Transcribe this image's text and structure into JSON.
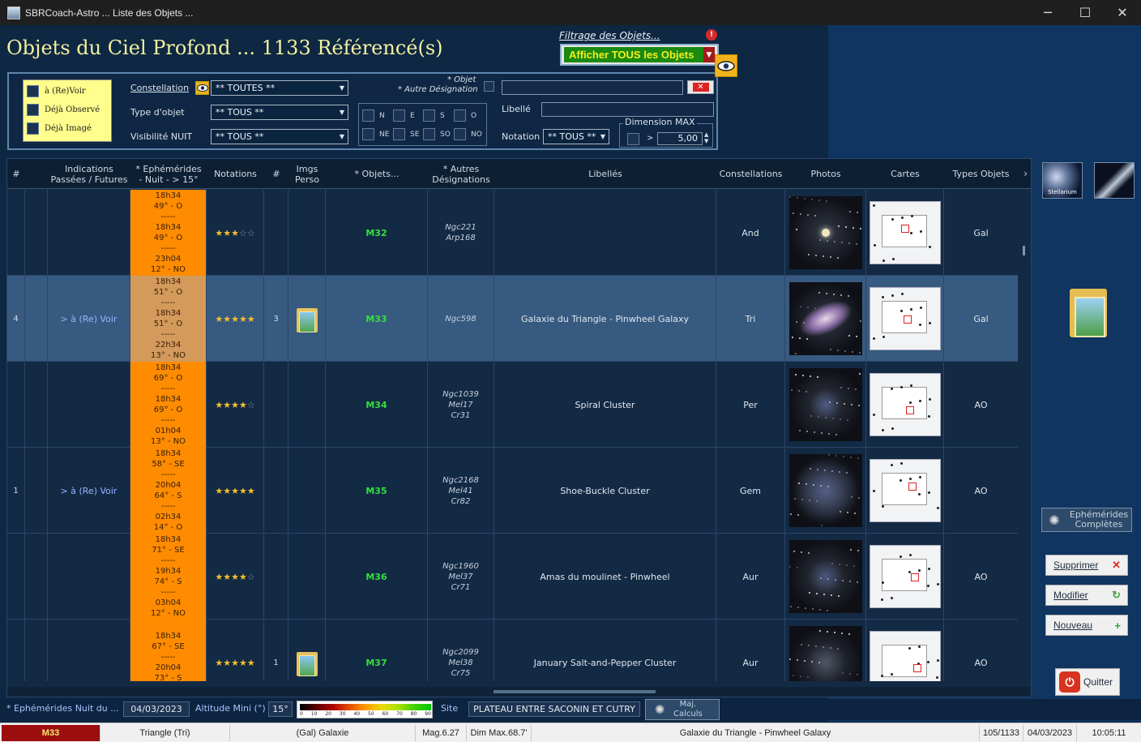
{
  "window": {
    "title": "SBRCoach-Astro ... Liste des Objets ...",
    "minimize": "─",
    "maximize": "☐",
    "close": "✕"
  },
  "header": {
    "title": "Objets du Ciel Profond ... 1133 Référencé(s)"
  },
  "filter": {
    "label": "Filtrage des Objets...",
    "badge": "!",
    "selected": "Afficher TOUS les Objets"
  },
  "legend": {
    "items": [
      "à (Re)Voir",
      "Déjà Observé",
      "Déjà Imagé"
    ]
  },
  "filters": {
    "constellation_label": "Constellation",
    "constellation_value": "** TOUTES **",
    "type_label": "Type d'objet",
    "type_value": "** TOUS **",
    "visibility_label": "Visibilité NUIT",
    "visibility_value": "** TOUS **",
    "object_label_1": "* Objet",
    "object_label_2": "* Autre Désignation",
    "object_value": "",
    "clear_label": "✕",
    "libelle_label": "Libellé",
    "libelle_value": "",
    "directions": [
      "N",
      "E",
      "S",
      "O",
      "NE",
      "SE",
      "SO",
      "NO"
    ],
    "notation_label": "Notation",
    "notation_value": "** TOUS **",
    "dimension_label": "Dimension MAX",
    "dimension_op": ">",
    "dimension_value": "5,00"
  },
  "table": {
    "headers": {
      "num": "#",
      "indications": "Indications\nPassées / Futures",
      "ephemerides": "* Ephémérides\n- Nuit - > 15°",
      "notations": "Notations",
      "hash": "#",
      "imgs": "Imgs\nPerso",
      "objets": "* Objets...",
      "autres": "* Autres\nDésignations",
      "libelles": "Libellés",
      "constellations": "Constellations",
      "photos": "Photos",
      "cartes": "Cartes",
      "types": "Types Objets"
    },
    "rows": [
      {
        "num": "",
        "indication": "",
        "eph": [
          "18h34",
          "49° - O",
          "-----",
          "18h34",
          "49° - O",
          "-----",
          "23h04",
          "12° - NO"
        ],
        "stars": 3,
        "hash": "",
        "has_img": false,
        "obj": "M32",
        "alt": [
          "Ngc221",
          "Arp168"
        ],
        "libelle": "",
        "const": "And",
        "type": "Gal"
      },
      {
        "num": "4",
        "indication": "> à (Re) Voir",
        "eph": [
          "18h34",
          "51° - O",
          "-----",
          "18h34",
          "51° - O",
          "-----",
          "22h34",
          "13° - NO"
        ],
        "stars": 5,
        "hash": "3",
        "has_img": true,
        "obj": "M33",
        "alt": [
          "Ngc598"
        ],
        "libelle": "Galaxie du Triangle - Pinwheel Galaxy",
        "const": "Tri",
        "type": "Gal"
      },
      {
        "num": "",
        "indication": "",
        "eph": [
          "18h34",
          "69° - O",
          "-----",
          "18h34",
          "69° - O",
          "-----",
          "01h04",
          "13° - NO"
        ],
        "stars": 4,
        "hash": "",
        "has_img": false,
        "obj": "M34",
        "alt": [
          "Ngc1039",
          "Mel17",
          "Cr31"
        ],
        "libelle": "Spiral Cluster",
        "const": "Per",
        "type": "AO"
      },
      {
        "num": "1",
        "indication": "> à (Re) Voir",
        "eph": [
          "18h34",
          "58° - SE",
          "-----",
          "20h04",
          "64° - S",
          "-----",
          "02h34",
          "14° - O"
        ],
        "stars": 5,
        "hash": "",
        "has_img": false,
        "obj": "M35",
        "alt": [
          "Ngc2168",
          "Mel41",
          "Cr82"
        ],
        "libelle": "Shoe-Buckle Cluster",
        "const": "Gem",
        "type": "AO"
      },
      {
        "num": "",
        "indication": "",
        "eph": [
          "18h34",
          "71° - SE",
          "-----",
          "19h34",
          "74° - S",
          "-----",
          "03h04",
          "12° - NO"
        ],
        "stars": 4,
        "hash": "",
        "has_img": false,
        "obj": "M36",
        "alt": [
          "Ngc1960",
          "Mel37",
          "Cr71"
        ],
        "libelle": "Amas du moulinet - Pinwheel",
        "const": "Aur",
        "type": "AO"
      },
      {
        "num": "",
        "indication": "",
        "eph": [
          "18h34",
          "67° - SE",
          "-----",
          "20h04",
          "73° - S",
          "-----"
        ],
        "stars": 5,
        "hash": "1",
        "has_img": true,
        "obj": "M37",
        "alt": [
          "Ngc2099",
          "Mel38",
          "Cr75"
        ],
        "libelle": "January Salt-and-Pepper Cluster",
        "const": "Aur",
        "type": "AO"
      }
    ]
  },
  "side": {
    "stellarium_label": "Stellarium",
    "ephemerides_btn": "Ephémérides\nComplètes",
    "delete_btn": "Supprimer",
    "modify_btn": "Modifier",
    "new_btn": "Nouveau",
    "quit_btn": "Quitter"
  },
  "footer": {
    "eph_label": "* Ephémérides Nuit du ...",
    "eph_date": "04/03/2023",
    "alt_label": "Altitude Mini (°)",
    "alt_value": "15°",
    "scale_ticks": [
      "0",
      "10",
      "20",
      "30",
      "40",
      "50",
      "60",
      "70",
      "80",
      "90"
    ],
    "site_label": "Site",
    "site_value": "PLATEAU ENTRE SACONIN ET CUTRY",
    "maj_label": "Maj.\nCalculs"
  },
  "statusbar": {
    "object": "M33",
    "constellation": "Triangle (Tri)",
    "type": "(Gal) Galaxie",
    "mag": "Mag.6.27",
    "dim": "Dim Max.68.7'",
    "name": "Galaxie du Triangle - Pinwheel Galaxy",
    "count": "105/1133",
    "date": "04/03/2023",
    "time": "10:05:11"
  },
  "colors": {
    "accent_title": "#f3f1a0",
    "ephemerides_bg": "#ff8c00",
    "object_green": "#33e03d",
    "filter_green": "#1a8a12"
  }
}
